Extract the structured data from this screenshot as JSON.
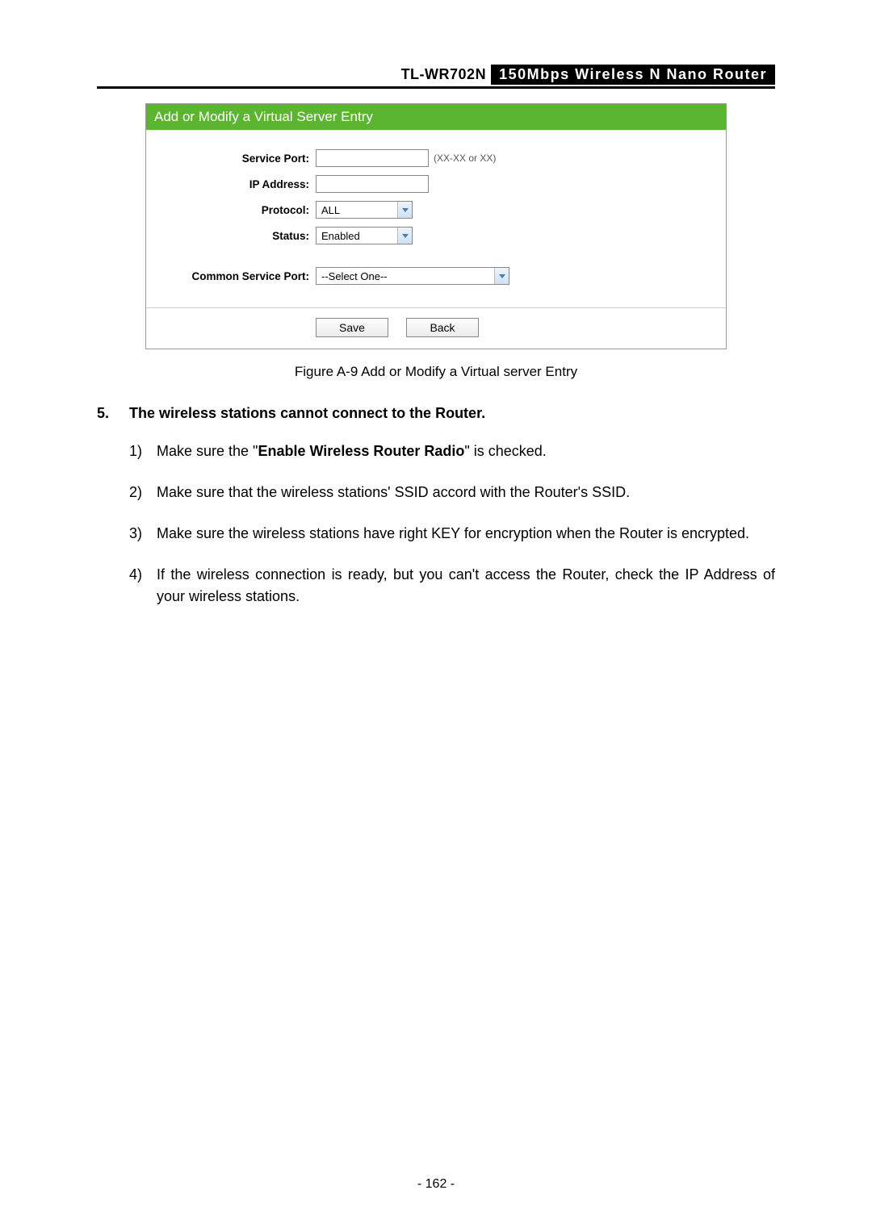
{
  "header": {
    "model": "TL-WR702N",
    "description": "150Mbps  Wireless  N  Nano  Router"
  },
  "panel": {
    "title": "Add or Modify a Virtual Server Entry",
    "fields": {
      "service_port_label": "Service Port:",
      "service_port_hint": "(XX-XX or XX)",
      "ip_address_label": "IP Address:",
      "protocol_label": "Protocol:",
      "protocol_value": "ALL",
      "status_label": "Status:",
      "status_value": "Enabled",
      "common_service_label": "Common Service Port:",
      "common_service_value": "--Select One--"
    },
    "buttons": {
      "save": "Save",
      "back": "Back"
    }
  },
  "caption": "Figure A-9    Add or Modify a Virtual server Entry",
  "section": {
    "number": "5.",
    "title": "The wireless stations cannot connect to the Router.",
    "items": [
      {
        "n": "1)",
        "pre": "Make sure the \"",
        "bold": "Enable Wireless Router Radio",
        "post": "\" is checked."
      },
      {
        "n": "2)",
        "text": "Make sure that the wireless stations' SSID accord with the Router's SSID."
      },
      {
        "n": "3)",
        "text": "Make sure the wireless stations have right KEY for encryption when the Router is encrypted."
      },
      {
        "n": "4)",
        "text": "If the wireless connection is ready, but you can't access the Router, check the IP Address of your wireless stations."
      }
    ]
  },
  "page_number": "- 162 -"
}
